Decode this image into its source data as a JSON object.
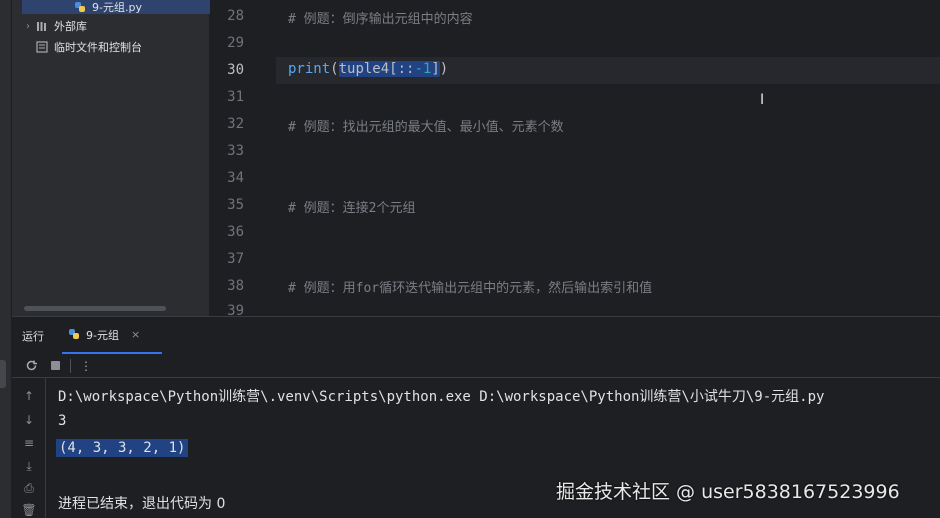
{
  "project_tree": {
    "selected_file": "9-元组.py",
    "items": [
      {
        "label": "外部库"
      },
      {
        "label": "临时文件和控制台"
      }
    ]
  },
  "editor": {
    "current_line": 30,
    "line_numbers": [
      "28",
      "29",
      "30",
      "31",
      "32",
      "33",
      "34",
      "35",
      "36",
      "37",
      "38",
      "39"
    ],
    "lines": {
      "l28": "# 例题：倒序输出元组中的内容",
      "l30_fn": "print",
      "l30_open": "(",
      "l30_sel_a": "tuple4[::",
      "l30_sel_num": "-1",
      "l30_sel_b": "]",
      "l30_close": ")",
      "l32": "# 例题：找出元组的最大值、最小值、元素个数",
      "l35": "# 例题：连接2个元组",
      "l38_a": "# 例题：用",
      "l38_kw": "for",
      "l38_b": "循环迭代输出元组中的元素，然后输出索引和值"
    },
    "text_cursor": "I"
  },
  "run_panel": {
    "title": "运行",
    "tab_label": "9-元组",
    "tab_close": "×",
    "more_menu": "⋮",
    "output": {
      "command": "D:\\workspace\\Python训练营\\.venv\\Scripts\\python.exe D:\\workspace\\Python训练营\\小试牛刀\\9-元组.py",
      "line1": "3",
      "line2": "(4, 3, 3, 2, 1)",
      "exit": "进程已结束，退出代码为 0"
    }
  },
  "watermark": "掘金技术社区 @ user5838167523996",
  "icons": {
    "python_file": "python-icon",
    "library": "library-icon",
    "scratches": "scratches-icon",
    "lightbulb": "lightbulb-icon",
    "rerun": "rerun-icon",
    "stop": "stop-icon"
  },
  "colors": {
    "background": "#1e1f22",
    "panel": "#2b2d30",
    "selection": "#214283",
    "function": "#56a8f5",
    "number": "#2aacb8",
    "comment": "#7a7e85",
    "accent": "#3574f0"
  }
}
